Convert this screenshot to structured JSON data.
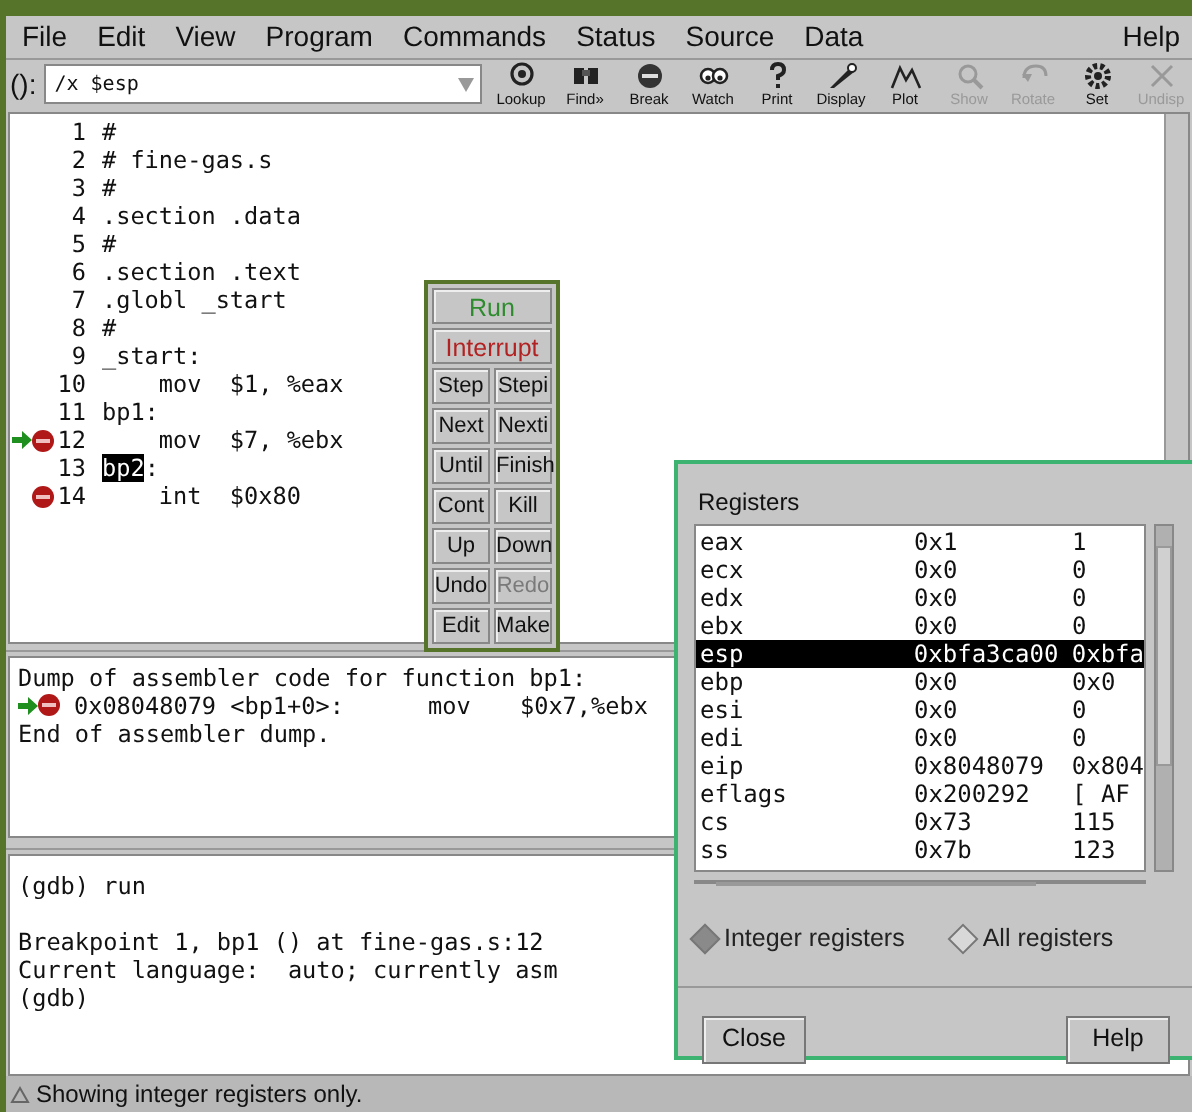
{
  "menu": [
    {
      "label": "File"
    },
    {
      "label": "Edit"
    },
    {
      "label": "View"
    },
    {
      "label": "Program"
    },
    {
      "label": "Commands"
    },
    {
      "label": "Status"
    },
    {
      "label": "Source"
    },
    {
      "label": "Data"
    },
    {
      "label": "Help"
    }
  ],
  "toolbar": {
    "arg_label": "():",
    "arg_value": "/x $esp",
    "buttons": [
      {
        "label": "Lookup",
        "kind": "lookup",
        "disabled": false
      },
      {
        "label": "Find»",
        "kind": "find",
        "disabled": false
      },
      {
        "label": "Break",
        "kind": "break",
        "disabled": false
      },
      {
        "label": "Watch",
        "kind": "watch",
        "disabled": false
      },
      {
        "label": "Print",
        "kind": "print",
        "disabled": false
      },
      {
        "label": "Display",
        "kind": "display",
        "disabled": false
      },
      {
        "label": "Plot",
        "kind": "plot",
        "disabled": false
      },
      {
        "label": "Show",
        "kind": "show",
        "disabled": true
      },
      {
        "label": "Rotate",
        "kind": "rotate",
        "disabled": true
      },
      {
        "label": "Set",
        "kind": "set",
        "disabled": false
      },
      {
        "label": "Undisp",
        "kind": "undisp",
        "disabled": true
      }
    ]
  },
  "source": {
    "lines": [
      {
        "number": "1",
        "code": "#",
        "execution_point": false,
        "breakpoint": false
      },
      {
        "number": "2",
        "code": "# fine-gas.s",
        "execution_point": false,
        "breakpoint": false
      },
      {
        "number": "3",
        "code": "#",
        "execution_point": false,
        "breakpoint": false
      },
      {
        "number": "4",
        "code": ".section .data",
        "execution_point": false,
        "breakpoint": false
      },
      {
        "number": "5",
        "code": "#",
        "execution_point": false,
        "breakpoint": false
      },
      {
        "number": "6",
        "code": ".section .text",
        "execution_point": false,
        "breakpoint": false
      },
      {
        "number": "7",
        "code": ".globl _start",
        "execution_point": false,
        "breakpoint": false
      },
      {
        "number": "8",
        "code": "#",
        "execution_point": false,
        "breakpoint": false
      },
      {
        "number": "9",
        "code": "_start:",
        "execution_point": false,
        "breakpoint": false
      },
      {
        "number": "10",
        "code": "    mov  $1, %eax",
        "execution_point": false,
        "breakpoint": false
      },
      {
        "number": "11",
        "code": "bp1:",
        "execution_point": false,
        "breakpoint": false
      },
      {
        "number": "12",
        "code": "    mov  $7, %ebx",
        "execution_point": true,
        "breakpoint": true
      },
      {
        "number": "13",
        "selection": "bp2",
        "code": ":",
        "execution_point": false,
        "breakpoint": false
      },
      {
        "number": "14",
        "code": "    int  $0x80",
        "execution_point": false,
        "breakpoint": true
      }
    ]
  },
  "command_tool": {
    "wide_buttons": [
      {
        "label": "Run",
        "color": "#2e8b2e"
      },
      {
        "label": "Interrupt",
        "color": "#b22222"
      }
    ],
    "buttons": [
      {
        "label": "Step",
        "disabled": false
      },
      {
        "label": "Stepi",
        "disabled": false
      },
      {
        "label": "Next",
        "disabled": false
      },
      {
        "label": "Nexti",
        "disabled": false
      },
      {
        "label": "Until",
        "disabled": false
      },
      {
        "label": "Finish",
        "disabled": false
      },
      {
        "label": "Cont",
        "disabled": false
      },
      {
        "label": "Kill",
        "disabled": false
      },
      {
        "label": "Up",
        "disabled": false
      },
      {
        "label": "Down",
        "disabled": false
      },
      {
        "label": "Undo",
        "disabled": false
      },
      {
        "label": "Redo",
        "disabled": true
      },
      {
        "label": "Edit",
        "disabled": false
      },
      {
        "label": "Make",
        "disabled": false
      }
    ]
  },
  "disassembly": {
    "header": "Dump of assembler code for function bp1:",
    "lines": [
      {
        "address": "0x08048079 <bp1+0>:",
        "mnemonic": "mov",
        "operands": "$0x7,%ebx",
        "execution_point": true,
        "breakpoint": true
      }
    ],
    "footer": "End of assembler dump."
  },
  "console": {
    "paragraphs": [
      [
        "(gdb) run"
      ],
      [
        "Breakpoint 1, bp1 () at fine-gas.s:12",
        "Current language:  auto; currently asm",
        "(gdb)"
      ]
    ]
  },
  "status_bar": {
    "text": "Showing integer registers only."
  },
  "registers_dialog": {
    "title": "Registers",
    "rows": [
      {
        "name": "eax",
        "hex": "0x1",
        "natural": "1",
        "selected": false
      },
      {
        "name": "ecx",
        "hex": "0x0",
        "natural": "0",
        "selected": false
      },
      {
        "name": "edx",
        "hex": "0x0",
        "natural": "0",
        "selected": false
      },
      {
        "name": "ebx",
        "hex": "0x0",
        "natural": "0",
        "selected": false
      },
      {
        "name": "esp",
        "hex": "0xbfa3ca00",
        "natural": "0xbfa",
        "selected": true
      },
      {
        "name": "ebp",
        "hex": "0x0",
        "natural": "0x0",
        "selected": false
      },
      {
        "name": "esi",
        "hex": "0x0",
        "natural": "0",
        "selected": false
      },
      {
        "name": "edi",
        "hex": "0x0",
        "natural": "0",
        "selected": false
      },
      {
        "name": "eip",
        "hex": "0x8048079",
        "natural": "0x804",
        "selected": false
      },
      {
        "name": "eflags",
        "hex": "0x200292",
        "natural": "[ AF",
        "selected": false
      },
      {
        "name": "cs",
        "hex": "0x73",
        "natural": "115",
        "selected": false
      },
      {
        "name": "ss",
        "hex": "0x7b",
        "natural": "123",
        "selected": false
      }
    ],
    "options": [
      {
        "label": "Integer registers",
        "selected": true
      },
      {
        "label": "All registers",
        "selected": false
      }
    ],
    "buttons": [
      {
        "label": "Close"
      },
      {
        "label": "Help"
      }
    ]
  }
}
